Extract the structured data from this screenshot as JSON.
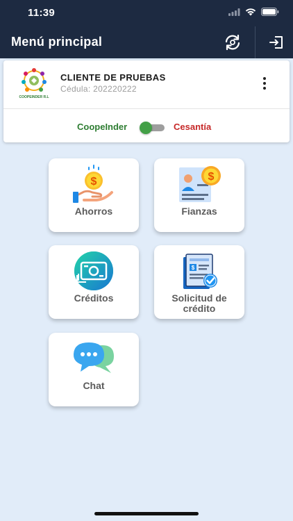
{
  "status": {
    "time": "11:39"
  },
  "appbar": {
    "title": "Menú principal",
    "sync_icon": "sync-icon",
    "logout_icon": "logout-icon"
  },
  "profile": {
    "logo_text": "COOPEINDER R.L",
    "name": "CLIENTE DE PRUEBAS",
    "cedula": "Cédula: 202220222",
    "toggle": {
      "left_label": "CoopeInder",
      "right_label": "Cesantía",
      "on": true
    }
  },
  "menu": [
    {
      "label": "Ahorros",
      "icon": "savings-hand-coin-icon"
    },
    {
      "label": "Fianzas",
      "icon": "guarantee-document-coin-icon"
    },
    {
      "label": "Créditos",
      "icon": "money-bill-icon"
    },
    {
      "label_line1": "Solicitud de",
      "label_line2": "crédito",
      "icon": "credit-application-document-icon"
    },
    {
      "label": "Chat",
      "icon": "chat-bubbles-icon"
    }
  ],
  "colors": {
    "appbar": "#1d2a41",
    "background": "#e1ecf9",
    "green": "#2e7d32",
    "red": "#c62828"
  }
}
